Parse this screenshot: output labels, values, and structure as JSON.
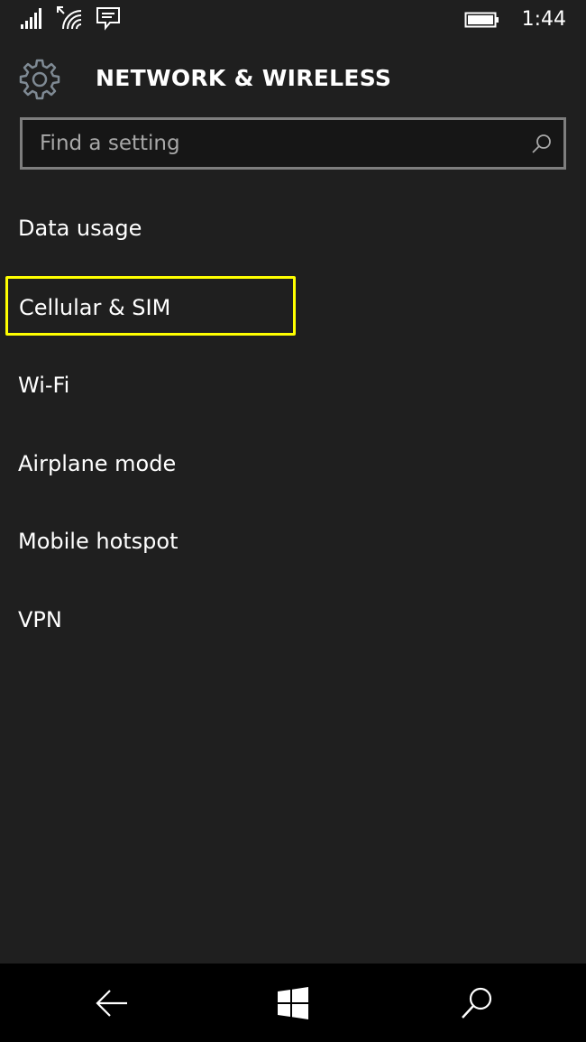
{
  "status_bar": {
    "icons": [
      "signal-strength-icon",
      "wifi-icon",
      "message-icon",
      "battery-icon"
    ],
    "time": "1:44"
  },
  "header": {
    "icon": "gear-icon",
    "title": "NETWORK & WIRELESS"
  },
  "search": {
    "placeholder": "Find a setting",
    "value": "",
    "icon": "search-icon"
  },
  "settings": {
    "items": [
      {
        "label": "Data usage"
      },
      {
        "label": "Cellular & SIM"
      },
      {
        "label": "Wi-Fi"
      },
      {
        "label": "Airplane mode"
      },
      {
        "label": "Mobile hotspot"
      },
      {
        "label": "VPN"
      }
    ],
    "highlighted_item": "Cellular & SIM"
  },
  "nav_bar": {
    "buttons": [
      "back-arrow-icon",
      "windows-logo-icon",
      "search-icon"
    ]
  },
  "colors": {
    "background": "#1f1f1f",
    "nav_background": "#000000",
    "highlight": "#ffff00",
    "search_border": "#7e7e7e",
    "text": "#ffffff"
  }
}
